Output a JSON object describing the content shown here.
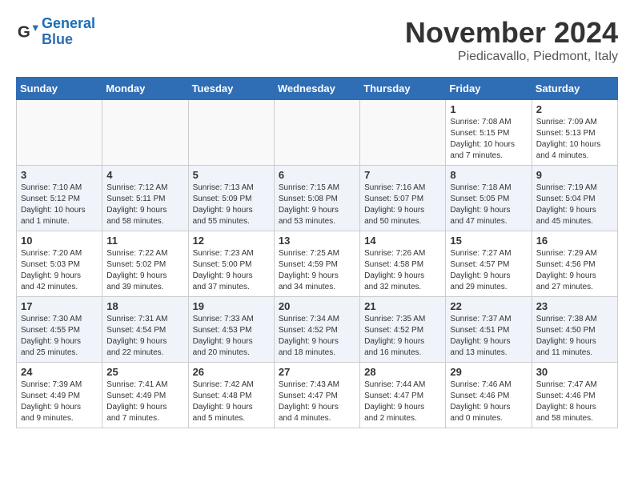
{
  "logo": {
    "line1": "General",
    "line2": "Blue"
  },
  "title": "November 2024",
  "subtitle": "Piedicavallo, Piedmont, Italy",
  "weekdays": [
    "Sunday",
    "Monday",
    "Tuesday",
    "Wednesday",
    "Thursday",
    "Friday",
    "Saturday"
  ],
  "weeks": [
    [
      {
        "day": "",
        "info": ""
      },
      {
        "day": "",
        "info": ""
      },
      {
        "day": "",
        "info": ""
      },
      {
        "day": "",
        "info": ""
      },
      {
        "day": "",
        "info": ""
      },
      {
        "day": "1",
        "info": "Sunrise: 7:08 AM\nSunset: 5:15 PM\nDaylight: 10 hours\nand 7 minutes."
      },
      {
        "day": "2",
        "info": "Sunrise: 7:09 AM\nSunset: 5:13 PM\nDaylight: 10 hours\nand 4 minutes."
      }
    ],
    [
      {
        "day": "3",
        "info": "Sunrise: 7:10 AM\nSunset: 5:12 PM\nDaylight: 10 hours\nand 1 minute."
      },
      {
        "day": "4",
        "info": "Sunrise: 7:12 AM\nSunset: 5:11 PM\nDaylight: 9 hours\nand 58 minutes."
      },
      {
        "day": "5",
        "info": "Sunrise: 7:13 AM\nSunset: 5:09 PM\nDaylight: 9 hours\nand 55 minutes."
      },
      {
        "day": "6",
        "info": "Sunrise: 7:15 AM\nSunset: 5:08 PM\nDaylight: 9 hours\nand 53 minutes."
      },
      {
        "day": "7",
        "info": "Sunrise: 7:16 AM\nSunset: 5:07 PM\nDaylight: 9 hours\nand 50 minutes."
      },
      {
        "day": "8",
        "info": "Sunrise: 7:18 AM\nSunset: 5:05 PM\nDaylight: 9 hours\nand 47 minutes."
      },
      {
        "day": "9",
        "info": "Sunrise: 7:19 AM\nSunset: 5:04 PM\nDaylight: 9 hours\nand 45 minutes."
      }
    ],
    [
      {
        "day": "10",
        "info": "Sunrise: 7:20 AM\nSunset: 5:03 PM\nDaylight: 9 hours\nand 42 minutes."
      },
      {
        "day": "11",
        "info": "Sunrise: 7:22 AM\nSunset: 5:02 PM\nDaylight: 9 hours\nand 39 minutes."
      },
      {
        "day": "12",
        "info": "Sunrise: 7:23 AM\nSunset: 5:00 PM\nDaylight: 9 hours\nand 37 minutes."
      },
      {
        "day": "13",
        "info": "Sunrise: 7:25 AM\nSunset: 4:59 PM\nDaylight: 9 hours\nand 34 minutes."
      },
      {
        "day": "14",
        "info": "Sunrise: 7:26 AM\nSunset: 4:58 PM\nDaylight: 9 hours\nand 32 minutes."
      },
      {
        "day": "15",
        "info": "Sunrise: 7:27 AM\nSunset: 4:57 PM\nDaylight: 9 hours\nand 29 minutes."
      },
      {
        "day": "16",
        "info": "Sunrise: 7:29 AM\nSunset: 4:56 PM\nDaylight: 9 hours\nand 27 minutes."
      }
    ],
    [
      {
        "day": "17",
        "info": "Sunrise: 7:30 AM\nSunset: 4:55 PM\nDaylight: 9 hours\nand 25 minutes."
      },
      {
        "day": "18",
        "info": "Sunrise: 7:31 AM\nSunset: 4:54 PM\nDaylight: 9 hours\nand 22 minutes."
      },
      {
        "day": "19",
        "info": "Sunrise: 7:33 AM\nSunset: 4:53 PM\nDaylight: 9 hours\nand 20 minutes."
      },
      {
        "day": "20",
        "info": "Sunrise: 7:34 AM\nSunset: 4:52 PM\nDaylight: 9 hours\nand 18 minutes."
      },
      {
        "day": "21",
        "info": "Sunrise: 7:35 AM\nSunset: 4:52 PM\nDaylight: 9 hours\nand 16 minutes."
      },
      {
        "day": "22",
        "info": "Sunrise: 7:37 AM\nSunset: 4:51 PM\nDaylight: 9 hours\nand 13 minutes."
      },
      {
        "day": "23",
        "info": "Sunrise: 7:38 AM\nSunset: 4:50 PM\nDaylight: 9 hours\nand 11 minutes."
      }
    ],
    [
      {
        "day": "24",
        "info": "Sunrise: 7:39 AM\nSunset: 4:49 PM\nDaylight: 9 hours\nand 9 minutes."
      },
      {
        "day": "25",
        "info": "Sunrise: 7:41 AM\nSunset: 4:49 PM\nDaylight: 9 hours\nand 7 minutes."
      },
      {
        "day": "26",
        "info": "Sunrise: 7:42 AM\nSunset: 4:48 PM\nDaylight: 9 hours\nand 5 minutes."
      },
      {
        "day": "27",
        "info": "Sunrise: 7:43 AM\nSunset: 4:47 PM\nDaylight: 9 hours\nand 4 minutes."
      },
      {
        "day": "28",
        "info": "Sunrise: 7:44 AM\nSunset: 4:47 PM\nDaylight: 9 hours\nand 2 minutes."
      },
      {
        "day": "29",
        "info": "Sunrise: 7:46 AM\nSunset: 4:46 PM\nDaylight: 9 hours\nand 0 minutes."
      },
      {
        "day": "30",
        "info": "Sunrise: 7:47 AM\nSunset: 4:46 PM\nDaylight: 8 hours\nand 58 minutes."
      }
    ]
  ]
}
